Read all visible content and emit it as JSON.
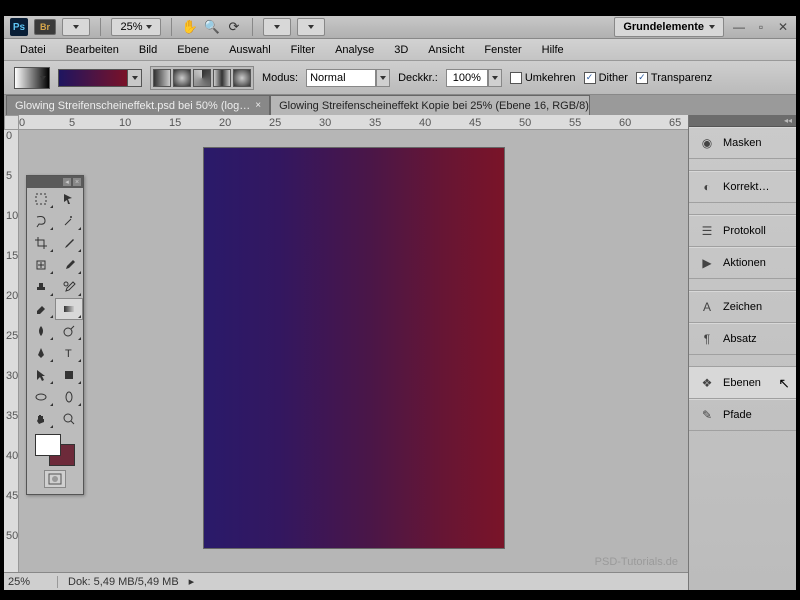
{
  "titlebar": {
    "zoom": "25% ",
    "workspace": "Grundelemente"
  },
  "menu": {
    "file": "Datei",
    "edit": "Bearbeiten",
    "image": "Bild",
    "layer": "Ebene",
    "select": "Auswahl",
    "filter": "Filter",
    "analysis": "Analyse",
    "threeD": "3D",
    "view": "Ansicht",
    "window": "Fenster",
    "help": "Hilfe"
  },
  "options": {
    "mode_label": "Modus:",
    "mode_value": "Normal",
    "opacity_label": "Deckkr.:",
    "opacity_value": "100%",
    "reverse": "Umkehren",
    "dither": "Dither",
    "transparency": "Transparenz"
  },
  "tabs": {
    "t1": "Glowing Streifenscheineffekt.psd bei 50% (log…",
    "t2": "Glowing Streifenscheineffekt Kopie bei 25% (Ebene 16, RGB/8) *"
  },
  "sidebar": {
    "masks": "Masken",
    "adjust": "Korrekt…",
    "history": "Protokoll",
    "actions": "Aktionen",
    "character": "Zeichen",
    "paragraph": "Absatz",
    "layers": "Ebenen",
    "paths": "Pfade"
  },
  "status": {
    "zoom": "25%",
    "docsize": "Dok: 5,49 MB/5,49 MB"
  },
  "ruler_h": [
    "0",
    "5",
    "10",
    "15",
    "20",
    "25",
    "30",
    "35",
    "40",
    "45",
    "50",
    "55",
    "60",
    "65"
  ],
  "ruler_v": [
    "0",
    "5",
    "10",
    "15",
    "20",
    "25",
    "30",
    "35",
    "40",
    "45",
    "50"
  ],
  "watermark": "PSD-Tutorials.de"
}
